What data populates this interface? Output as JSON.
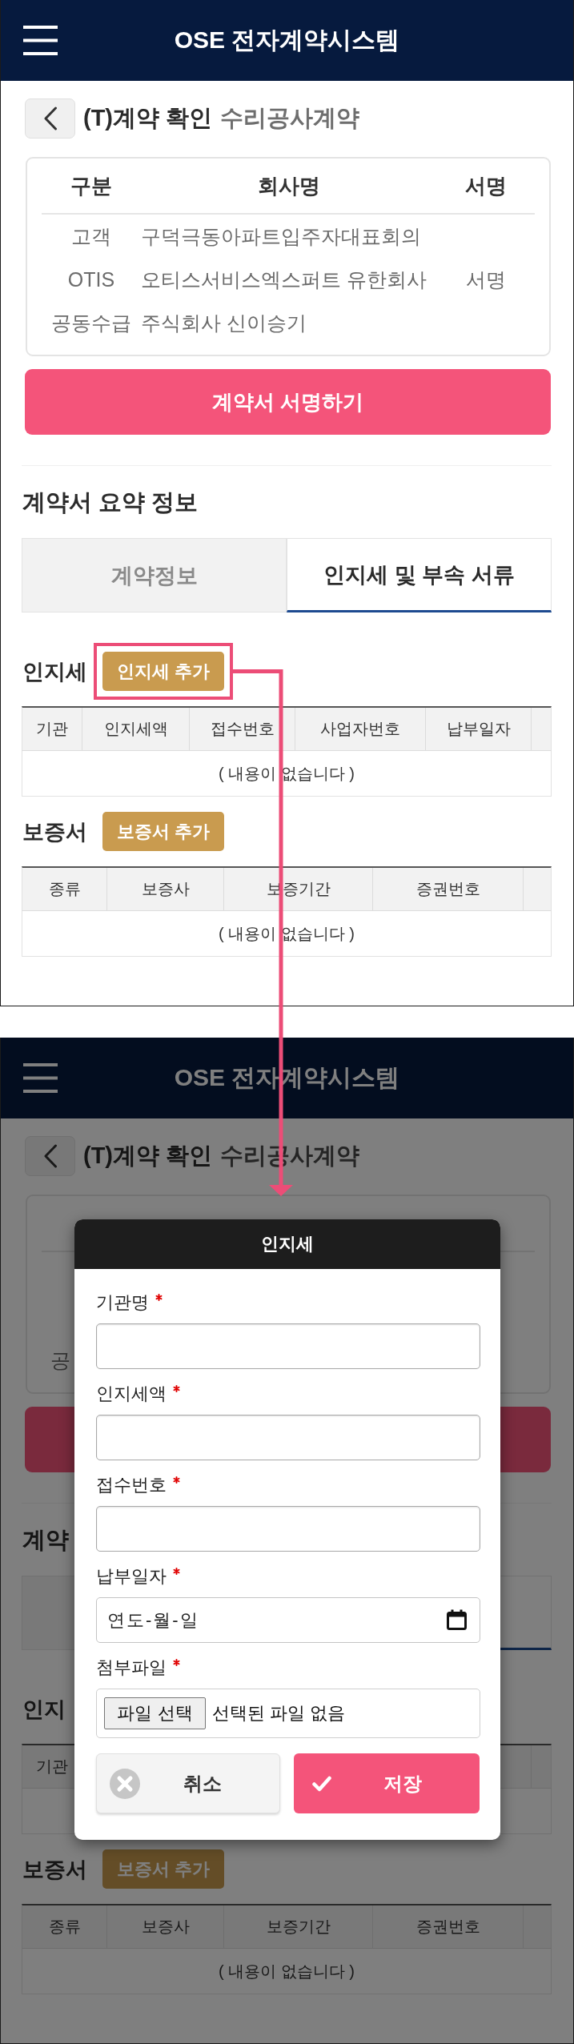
{
  "screens": [
    {
      "header": {
        "title": "OSE 전자계약시스템"
      },
      "page_title": {
        "title": "(T)계약 확인",
        "subtitle": "수리공사계약"
      },
      "parties": {
        "columns": [
          "구분",
          "회사명",
          "서명"
        ],
        "rows": [
          {
            "division": "고객",
            "company": "구덕극동아파트입주자대표회의"
          },
          {
            "division": "OTIS",
            "company": "오티스서비스엑스퍼트 유한회사",
            "signature": "서명"
          },
          {
            "division": "공동수급",
            "company": "주식회사 신이승기"
          }
        ]
      },
      "sign_button": {
        "label": "계약서 서명하기"
      },
      "summary": {
        "heading": "계약서 요약 정보",
        "tabs": [
          {
            "label": "계약정보",
            "selected": false
          },
          {
            "label": "인지세 및 부속 서류",
            "selected": true
          }
        ]
      },
      "sections": [
        {
          "kind": "stamp",
          "heading": "인지세",
          "add_button": {
            "label": "인지세 추가",
            "highlighted": true
          },
          "table": {
            "columns": [
              {
                "label": "기관"
              },
              {
                "label": "인지세액"
              },
              {
                "label": "접수번호"
              },
              {
                "label": "사업자번호"
              },
              {
                "label": "납부일자"
              }
            ],
            "empty_text": "( 내용이 없습니다 )"
          }
        },
        {
          "kind": "bond",
          "heading": "보증서",
          "add_button": {
            "label": "보증서 추가",
            "highlighted": false
          },
          "table": {
            "columns": [
              {
                "label": "종류"
              },
              {
                "label": "보증사"
              },
              {
                "label": "보증기간"
              },
              {
                "label": "증권번호"
              }
            ],
            "empty_text": "( 내용이 없습니다 )"
          }
        }
      ]
    },
    {
      "header": {
        "title": "OSE 전자계약시스템"
      },
      "page_title": {
        "title": "(T)계약 확인",
        "subtitle": "수리공사계약"
      },
      "parties": {
        "rows": [
          {
            "division": "공"
          }
        ]
      },
      "summary": {
        "heading": "계약",
        "tabs": [
          {
            "selected": false
          },
          {
            "selected": true
          }
        ]
      },
      "sections": [
        {
          "kind": "stamp",
          "heading": "인지",
          "table": {
            "columns": [
              {
                "label": "기관"
              },
              {},
              {},
              {},
              {}
            ]
          }
        },
        {
          "kind": "bond",
          "heading": "보증서",
          "add_button": {
            "label": "보증서 추가",
            "highlighted": false
          },
          "table": {
            "columns": [
              {
                "label": "종류"
              },
              {
                "label": "보증사"
              },
              {
                "label": "보증기간"
              },
              {
                "label": "증권번호"
              }
            ],
            "empty_text": "( 내용이 없습니다 )"
          }
        }
      ],
      "modal": {
        "title": "인지세",
        "fields": [
          {
            "kind": "text",
            "label": "기관명",
            "required": true
          },
          {
            "kind": "text",
            "label": "인지세액",
            "required": true
          },
          {
            "kind": "text",
            "label": "접수번호",
            "required": true
          },
          {
            "kind": "date",
            "label": "납부일자",
            "required": true,
            "placeholder": "연도-월-일"
          },
          {
            "kind": "file",
            "label": "첨부파일",
            "required": true,
            "button": "파일 선택",
            "status": "선택된 파일 없음"
          }
        ],
        "buttons": [
          {
            "kind": "cancel",
            "label": "취소"
          },
          {
            "kind": "save",
            "label": "저장"
          }
        ]
      }
    }
  ]
}
